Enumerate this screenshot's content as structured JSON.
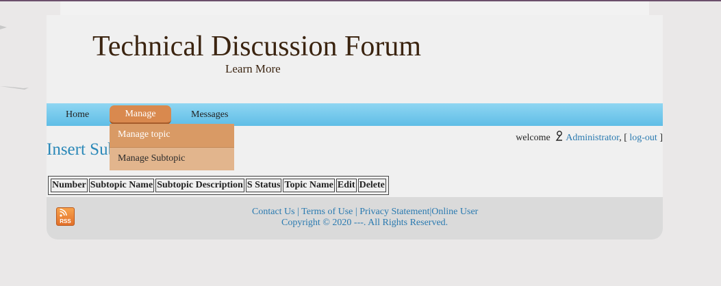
{
  "header": {
    "title": "Technical Discussion Forum",
    "subtitle": "Learn More"
  },
  "nav": {
    "home": "Home",
    "manage": "Manage",
    "messages": "Messages"
  },
  "manage_menu": {
    "items": [
      "Manage topic",
      "Manage Subtopic"
    ]
  },
  "welcome": {
    "prefix": "welcome",
    "user": "Administrator",
    "sep": ", [",
    "logout": "log-out",
    "suffix": "]"
  },
  "main": {
    "heading": "Insert Subtopic",
    "columns": [
      "Number",
      "Subtopic Name",
      "Subtopic Description",
      "S Status",
      "Topic Name",
      "Edit",
      "Delete"
    ]
  },
  "footer": {
    "links": [
      "Contact Us",
      "Terms of Use",
      "Privacy Statement",
      "Online User"
    ],
    "copyright": "Copyright © 2020 ---. All Rights Reserved.",
    "rss_icon": "rss-icon"
  },
  "colors": {
    "nav_bar": "#5fbde6",
    "manage_active": "#d9894e",
    "link": "#2a7ab0",
    "title": "#3b2410"
  }
}
